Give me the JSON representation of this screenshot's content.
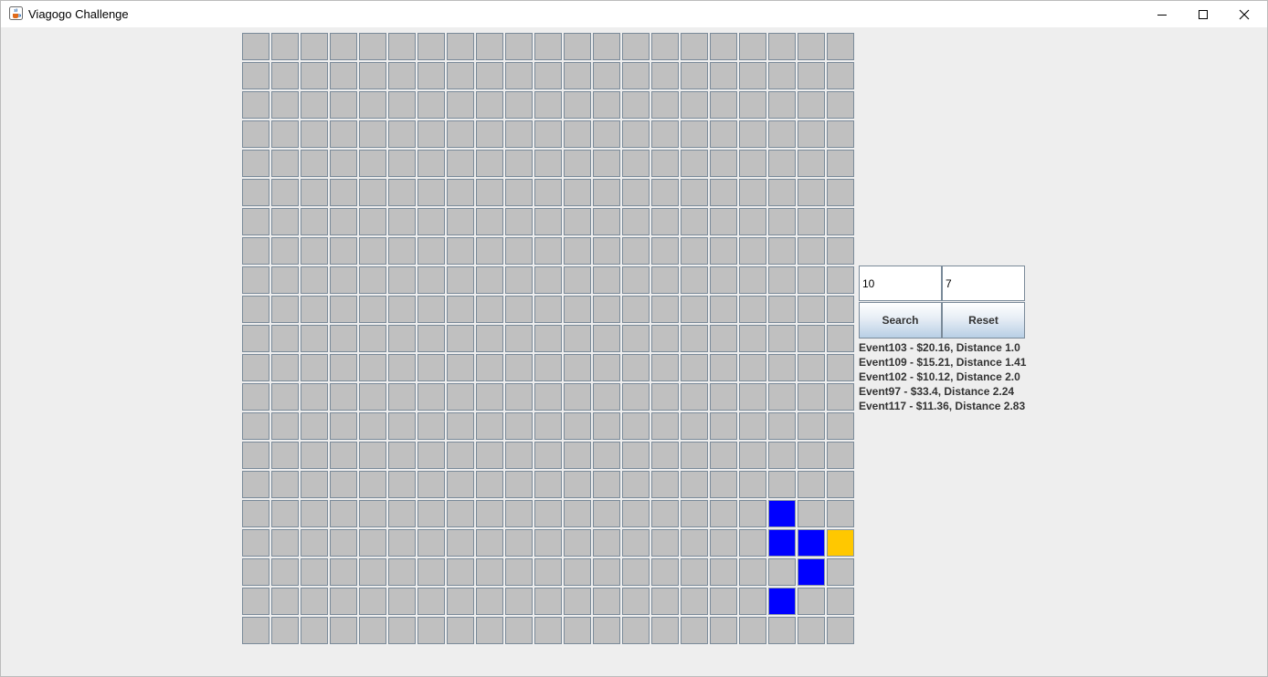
{
  "window": {
    "title": "Viagogo Challenge",
    "icon": "java-cup-icon",
    "controls": [
      "minimize-icon",
      "maximize-icon",
      "close-icon"
    ]
  },
  "grid": {
    "rows": 21,
    "cols": 21,
    "cell_color": "#c0c0c0",
    "event_color": "#0000ff",
    "user_color": "#ffc800",
    "event_cells": [
      {
        "row": 16,
        "col": 18
      },
      {
        "row": 17,
        "col": 18
      },
      {
        "row": 17,
        "col": 19
      },
      {
        "row": 18,
        "col": 19
      },
      {
        "row": 19,
        "col": 18
      }
    ],
    "user_cell": {
      "row": 17,
      "col": 20
    }
  },
  "search": {
    "x_value": "10",
    "y_value": "7",
    "search_label": "Search",
    "reset_label": "Reset"
  },
  "results": [
    "Event103 - $20.16, Distance 1.0",
    "Event109 - $15.21, Distance 1.41",
    "Event102 - $10.12, Distance 2.0",
    "Event97 - $33.4, Distance 2.24",
    "Event117 - $11.36, Distance 2.83"
  ]
}
